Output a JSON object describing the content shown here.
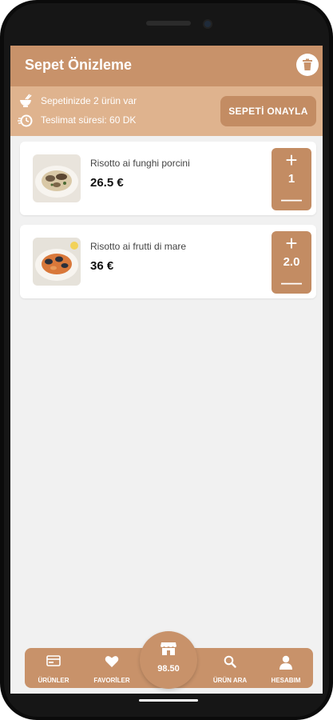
{
  "header": {
    "title": "Sepet Önizleme",
    "trash_icon": "trash-icon"
  },
  "info": {
    "items_text": "Sepetinizde 2 ürün var",
    "delivery_text": "Teslimat süresi: 60 DK",
    "confirm_label": "SEPETİ ONAYLA"
  },
  "cart": {
    "items": [
      {
        "name": "Risotto ai funghi porcini",
        "price": "26.5 €",
        "quantity": "1",
        "plus": "+",
        "minus": "—"
      },
      {
        "name": "Risotto ai frutti di mare",
        "price": "36 €",
        "quantity": "2.0",
        "plus": "+",
        "minus": "—"
      }
    ]
  },
  "bottom_nav": {
    "items": [
      {
        "label": "ÜRÜNLER",
        "icon": "products-icon"
      },
      {
        "label": "FAVORİLER",
        "icon": "heart-icon"
      },
      {
        "label": "ÜRÜN ARA",
        "icon": "search-icon"
      },
      {
        "label": "HESABIM",
        "icon": "account-icon"
      }
    ],
    "cart_total": "98.50",
    "cart_icon": "store-icon"
  },
  "colors": {
    "accent": "#c8926a",
    "accent_light": "#dfb38e",
    "accent_dark": "#c38c63",
    "background": "#f1f1f1"
  }
}
